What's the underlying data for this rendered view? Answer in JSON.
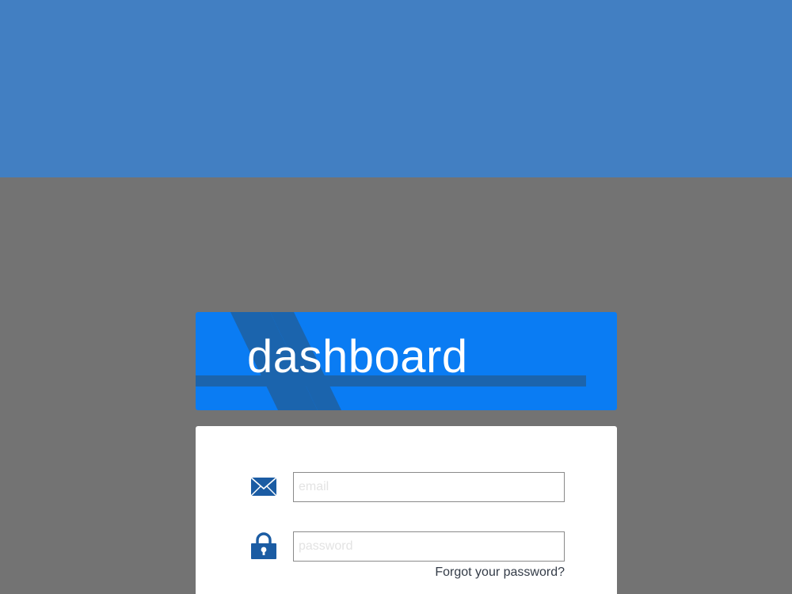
{
  "logo": {
    "text": "dashboard",
    "colors": {
      "background": "#0a7cf3",
      "stripe": "#1b64ad"
    }
  },
  "login": {
    "email": {
      "icon": "envelope-icon",
      "placeholder": "email",
      "value": ""
    },
    "password": {
      "icon": "lock-icon",
      "placeholder": "password",
      "value": ""
    },
    "forgot_password_label": "Forgot your password?"
  },
  "colors": {
    "top_band": "#427fc2",
    "page_background": "#737373",
    "card_background": "#ffffff",
    "icon": "#1b5ca3"
  }
}
